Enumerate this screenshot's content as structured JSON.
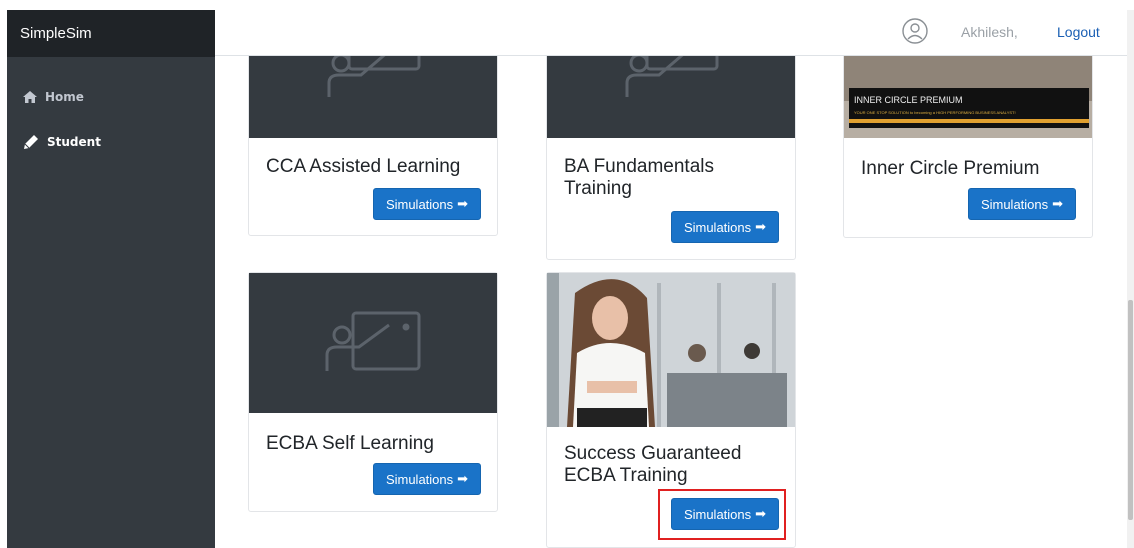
{
  "brand": "SimpleSim",
  "sidebar": {
    "items": [
      {
        "label": "Home",
        "icon": "home-icon"
      },
      {
        "label": "Student",
        "icon": "pencil-icon"
      }
    ]
  },
  "header": {
    "username": "Akhilesh,",
    "logout": "Logout"
  },
  "courses": [
    {
      "title": "CCA Assisted Learning",
      "button": "Simulations"
    },
    {
      "title": "BA Fundamentals Training",
      "button": "Simulations"
    },
    {
      "title": "Inner Circle Premium",
      "button": "Simulations",
      "banner_title": "INNER CIRCLE PREMIUM",
      "banner_sub": "YOUR ONE STOP SOLUTION to becoming a HIGH PERFORMING BUSINESS ANALYST!"
    },
    {
      "title": "ECBA Self Learning",
      "button": "Simulations"
    },
    {
      "title": "Success Guaranteed ECBA Training",
      "button": "Simulations"
    }
  ],
  "colors": {
    "sidebar": "#343a40",
    "brand_bg": "#1f2327",
    "button": "#1a73c8",
    "highlight": "#e02020"
  }
}
